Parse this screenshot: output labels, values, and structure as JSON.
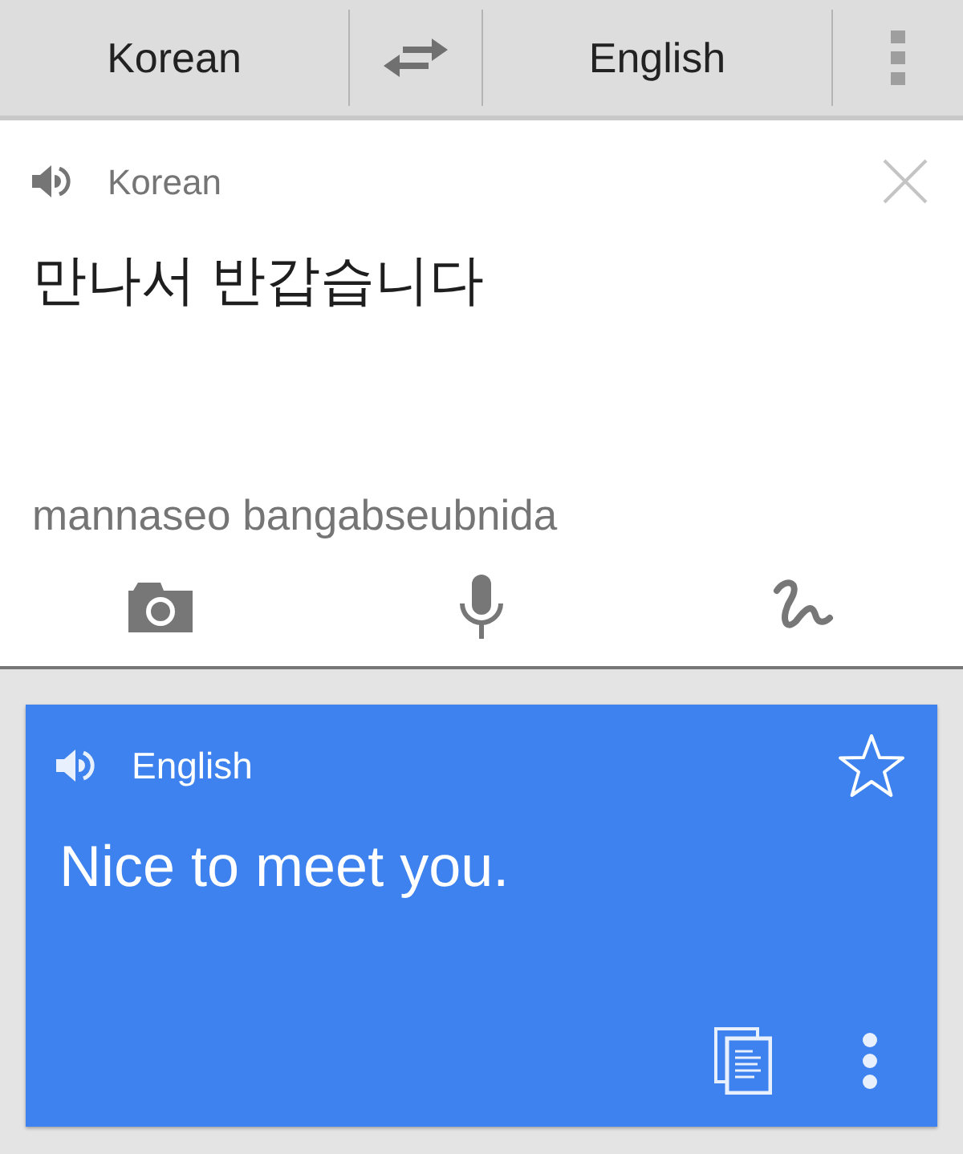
{
  "top_bar": {
    "source_language": "Korean",
    "target_language": "English"
  },
  "input_panel": {
    "language": "Korean",
    "text": "만나서 반갑습니다",
    "romanization": "mannaseo bangabseubnida"
  },
  "result_card": {
    "language": "English",
    "text": "Nice to meet you.",
    "starred": false
  }
}
